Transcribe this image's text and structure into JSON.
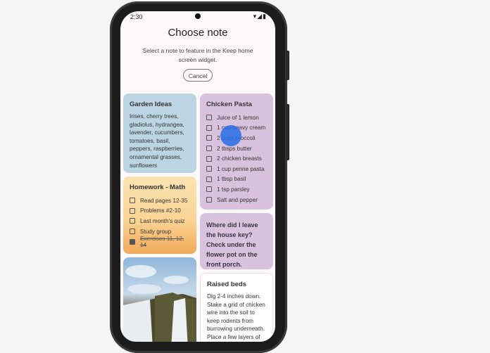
{
  "status_bar": {
    "time": "2:30",
    "icons": "▾◢▮"
  },
  "dialog": {
    "title": "Choose note",
    "subtitle": "Select a note to feature in the Keep home screen widget.",
    "cancel_label": "Cancel"
  },
  "notes": {
    "garden": {
      "title": "Garden Ideas",
      "body": "Irises, cherry trees, gladiolus, hydrangea, lavender, cucumbers, tomatoes, basil, peppers, raspberries, ornamental grasses, sunflowers",
      "color": "#bcd5e3"
    },
    "chicken": {
      "title": "Chicken Pasta",
      "color": "#d8c2dd",
      "items": [
        {
          "text": "Juice of 1 lemon",
          "checked": false
        },
        {
          "text": "1 cup heavy cream",
          "checked": false
        },
        {
          "text": "2 cups broccoli",
          "checked": false
        },
        {
          "text": "2 tbsps butter",
          "checked": false
        },
        {
          "text": "2 chicken breasts",
          "checked": false
        },
        {
          "text": "1 cup penne pasta",
          "checked": false
        },
        {
          "text": "1 tbsp basil",
          "checked": false
        },
        {
          "text": "1 tsp parsley",
          "checked": false
        },
        {
          "text": "Salt and pepper",
          "checked": false
        }
      ]
    },
    "homework": {
      "title": "Homework - Math",
      "items": [
        {
          "text": "Read pages 12-35",
          "checked": false
        },
        {
          "text": "Problems #2-10",
          "checked": false
        },
        {
          "text": "Last month's quiz",
          "checked": false
        },
        {
          "text": "Study group",
          "checked": false
        },
        {
          "text": "Exercises 11, 12, 14",
          "checked": true
        }
      ]
    },
    "house": {
      "body": "Where did I leave the house key? Check under the flower pot on the front porch.",
      "color": "#d8c2dd"
    },
    "image_note": {
      "alt": "waterfall-photo"
    },
    "raised": {
      "title": "Raised beds",
      "body": "Dig 2-4 inches down. Stake a grid of chicken wire into the soil to keep rodents from burrowing underneath. Place a few layers of"
    }
  }
}
